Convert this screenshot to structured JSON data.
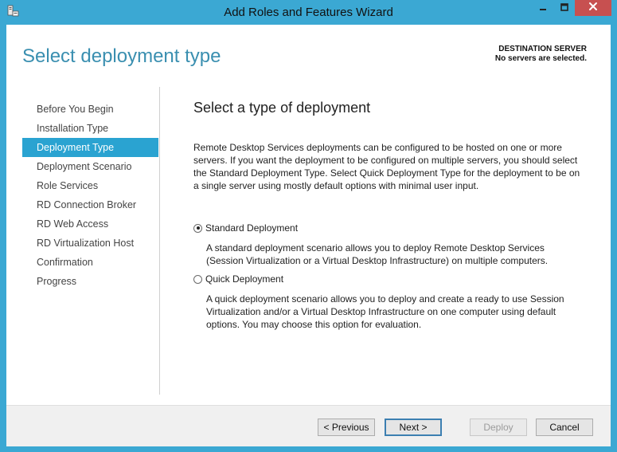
{
  "window": {
    "title": "Add Roles and Features Wizard"
  },
  "header": {
    "page_title": "Select deployment type",
    "destination_label": "DESTINATION SERVER",
    "destination_value": "No servers are selected."
  },
  "nav": {
    "items": [
      {
        "label": "Before You Begin"
      },
      {
        "label": "Installation Type"
      },
      {
        "label": "Deployment Type"
      },
      {
        "label": "Deployment Scenario"
      },
      {
        "label": "Role Services"
      },
      {
        "label": "RD Connection Broker"
      },
      {
        "label": "RD Web Access"
      },
      {
        "label": "RD Virtualization Host"
      },
      {
        "label": "Confirmation"
      },
      {
        "label": "Progress"
      }
    ],
    "active": "Deployment Type"
  },
  "content": {
    "heading": "Select a type of deployment",
    "intro": "Remote Desktop Services deployments can be configured to be hosted on one or more servers. If you want the deployment to be configured on multiple servers, you should select the Standard Deployment Type. Select Quick Deployment Type for the deployment to be on a single server using mostly default options with minimal user input.",
    "options": [
      {
        "label": "Standard Deployment",
        "selected": true,
        "description": "A standard deployment scenario allows you to deploy Remote Desktop Services (Session Virtualization or a Virtual Desktop Infrastructure) on multiple computers."
      },
      {
        "label": "Quick Deployment",
        "selected": false,
        "description": "A quick deployment scenario allows you to deploy and create a ready to use Session Virtualization and/or a Virtual Desktop Infrastructure on one computer using default options. You may choose this option for evaluation."
      }
    ]
  },
  "footer": {
    "previous_label": "< Previous",
    "next_label": "Next >",
    "deploy_label": "Deploy",
    "cancel_label": "Cancel"
  },
  "icons": {
    "app": "server-manager-icon",
    "minimize": "minimize-icon",
    "maximize": "maximize-icon",
    "close": "close-icon"
  },
  "colors": {
    "frame": "#3ba8d3",
    "accent": "#2aa3d1",
    "title_text": "#3a8fb0",
    "close_button": "#c75050"
  }
}
